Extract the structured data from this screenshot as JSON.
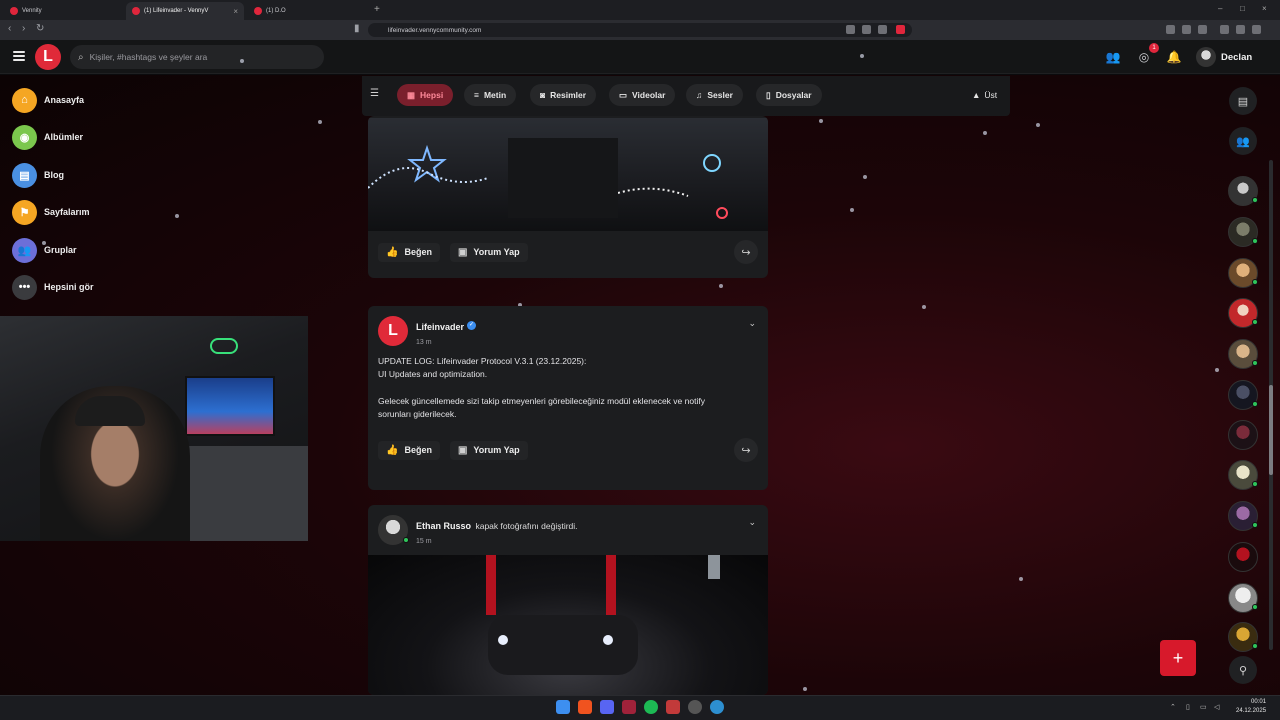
{
  "browser": {
    "tabs": [
      {
        "title": "Vennity",
        "active": false
      },
      {
        "title": "(1) Lifeinvader - VennyV",
        "active": true
      },
      {
        "title": "(1) D.O",
        "active": false
      }
    ],
    "url": "lifeinvader.vennycommunity.com"
  },
  "header": {
    "logo": "L",
    "search_placeholder": "Kişiler, #hashtags ve şeyler ara",
    "notif_count": "1",
    "username": "Declan"
  },
  "sidebar": {
    "items": [
      {
        "label": "Anasayfa",
        "icon": "home-icon",
        "color": "#f5a623"
      },
      {
        "label": "Albümler",
        "icon": "album-icon",
        "color": "#7bc74d"
      },
      {
        "label": "Blog",
        "icon": "blog-icon",
        "color": "#4a90e2"
      },
      {
        "label": "Sayfalarım",
        "icon": "flag-icon",
        "color": "#f5a623"
      },
      {
        "label": "Gruplar",
        "icon": "groups-icon",
        "color": "#6c6fd8"
      },
      {
        "label": "Hepsini gör",
        "icon": "more-icon",
        "color": "#3a3b3e"
      }
    ]
  },
  "filters": {
    "items": [
      {
        "label": "Hepsi",
        "icon": "all-icon",
        "active": true
      },
      {
        "label": "Metin",
        "icon": "text-icon",
        "active": false
      },
      {
        "label": "Resimler",
        "icon": "camera-icon",
        "active": false
      },
      {
        "label": "Videolar",
        "icon": "video-icon",
        "active": false
      },
      {
        "label": "Sesler",
        "icon": "music-icon",
        "active": false
      },
      {
        "label": "Dosyalar",
        "icon": "file-icon",
        "active": false
      }
    ],
    "top_label": "Üst"
  },
  "feed": {
    "like_label": "Beğen",
    "comment_label": "Yorum Yap",
    "posts": [
      {
        "author": "Lifeinvader",
        "time": "13 m",
        "verified": true,
        "text_line1": "UPDATE LOG: Lifeinvader Protocol V.3.1 (23.12.2025):",
        "text_line2": "UI Updates and optimization.",
        "text_line3": "Gelecek güncellemede sizi takip etmeyenleri görebileceğiniz modül eklenecek ve notify",
        "text_line4": "sorunları giderilecek."
      },
      {
        "author": "Ethan Russo",
        "action": "kapak fotoğrafını değiştirdi.",
        "time": "15 m"
      }
    ]
  },
  "taskbar": {
    "time": "00:01",
    "date": "24.12.2025"
  },
  "colors": {
    "brand": "#e02a39",
    "active_filter_bg": "#7a1f2c",
    "online": "#2fc55b"
  }
}
